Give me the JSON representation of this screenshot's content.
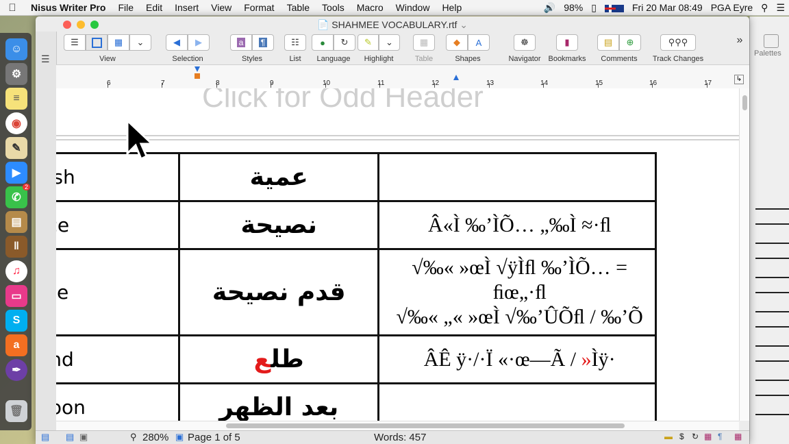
{
  "menubar": {
    "app_name": "Nisus Writer Pro",
    "items": [
      "File",
      "Edit",
      "Insert",
      "View",
      "Format",
      "Table",
      "Tools",
      "Macro",
      "Window",
      "Help"
    ],
    "battery": "98%",
    "datetime": "Fri 20 Mar  08:49",
    "user": "PGA Eyre"
  },
  "window": {
    "title": "SHAHMEE VOCABULARY.rtf",
    "title_chevron": "⌄"
  },
  "toolbar": {
    "view_label": "View",
    "selection_label": "Selection",
    "styles_label": "Styles",
    "list_label": "List",
    "language_label": "Language",
    "highlight_label": "Highlight",
    "table_label": "Table",
    "shapes_label": "Shapes",
    "navigator_label": "Navigator",
    "bookmarks_label": "Bookmarks",
    "comments_label": "Comments",
    "track_changes_label": "Track Changes",
    "overflow": "»"
  },
  "ruler": {
    "numbers": [
      "6",
      "7",
      "8",
      "9",
      "10",
      "11",
      "12",
      "13",
      "14",
      "15",
      "16",
      "17"
    ]
  },
  "document": {
    "header_placeholder": "Click for Odd Header",
    "rows": [
      {
        "english": "glish",
        "arabic": "عمية",
        "phonetic": ""
      },
      {
        "english": "vice",
        "arabic": "نصيحة",
        "phonetic": "Â«Ì ‰’ÌÕ… „‰Ì ≈·ﬂ"
      },
      {
        "english": "vise",
        "arabic": "قدم نصيحة",
        "phonetic_lines": [
          "√‰« »œÌ √ÿÌﬂ ‰’ÌÕ… =",
          "ﬁœ„·ﬂ",
          "√‰« „« »œÌ √‰’ÛÕﬂ / ‰’Õ"
        ]
      },
      {
        "english": "tend",
        "arabic_main": "طل",
        "arabic_red": "ع",
        "phonetic_main": "ÂÊ ÿ·/·Ï «·œ—Ã / ",
        "phonetic_red": "»",
        "phonetic_tail": "Ìÿ·"
      },
      {
        "english": "rnoon",
        "arabic": "بعد الظهر",
        "phonetic": ""
      }
    ]
  },
  "palettes": {
    "label": "Palettes"
  },
  "status": {
    "zoom": "280%",
    "page": "Page 1 of 5",
    "words": "Words: 457"
  },
  "colors": {
    "accent_red": "#e31b1b",
    "toolbar_blue": "#2a6fd6"
  }
}
